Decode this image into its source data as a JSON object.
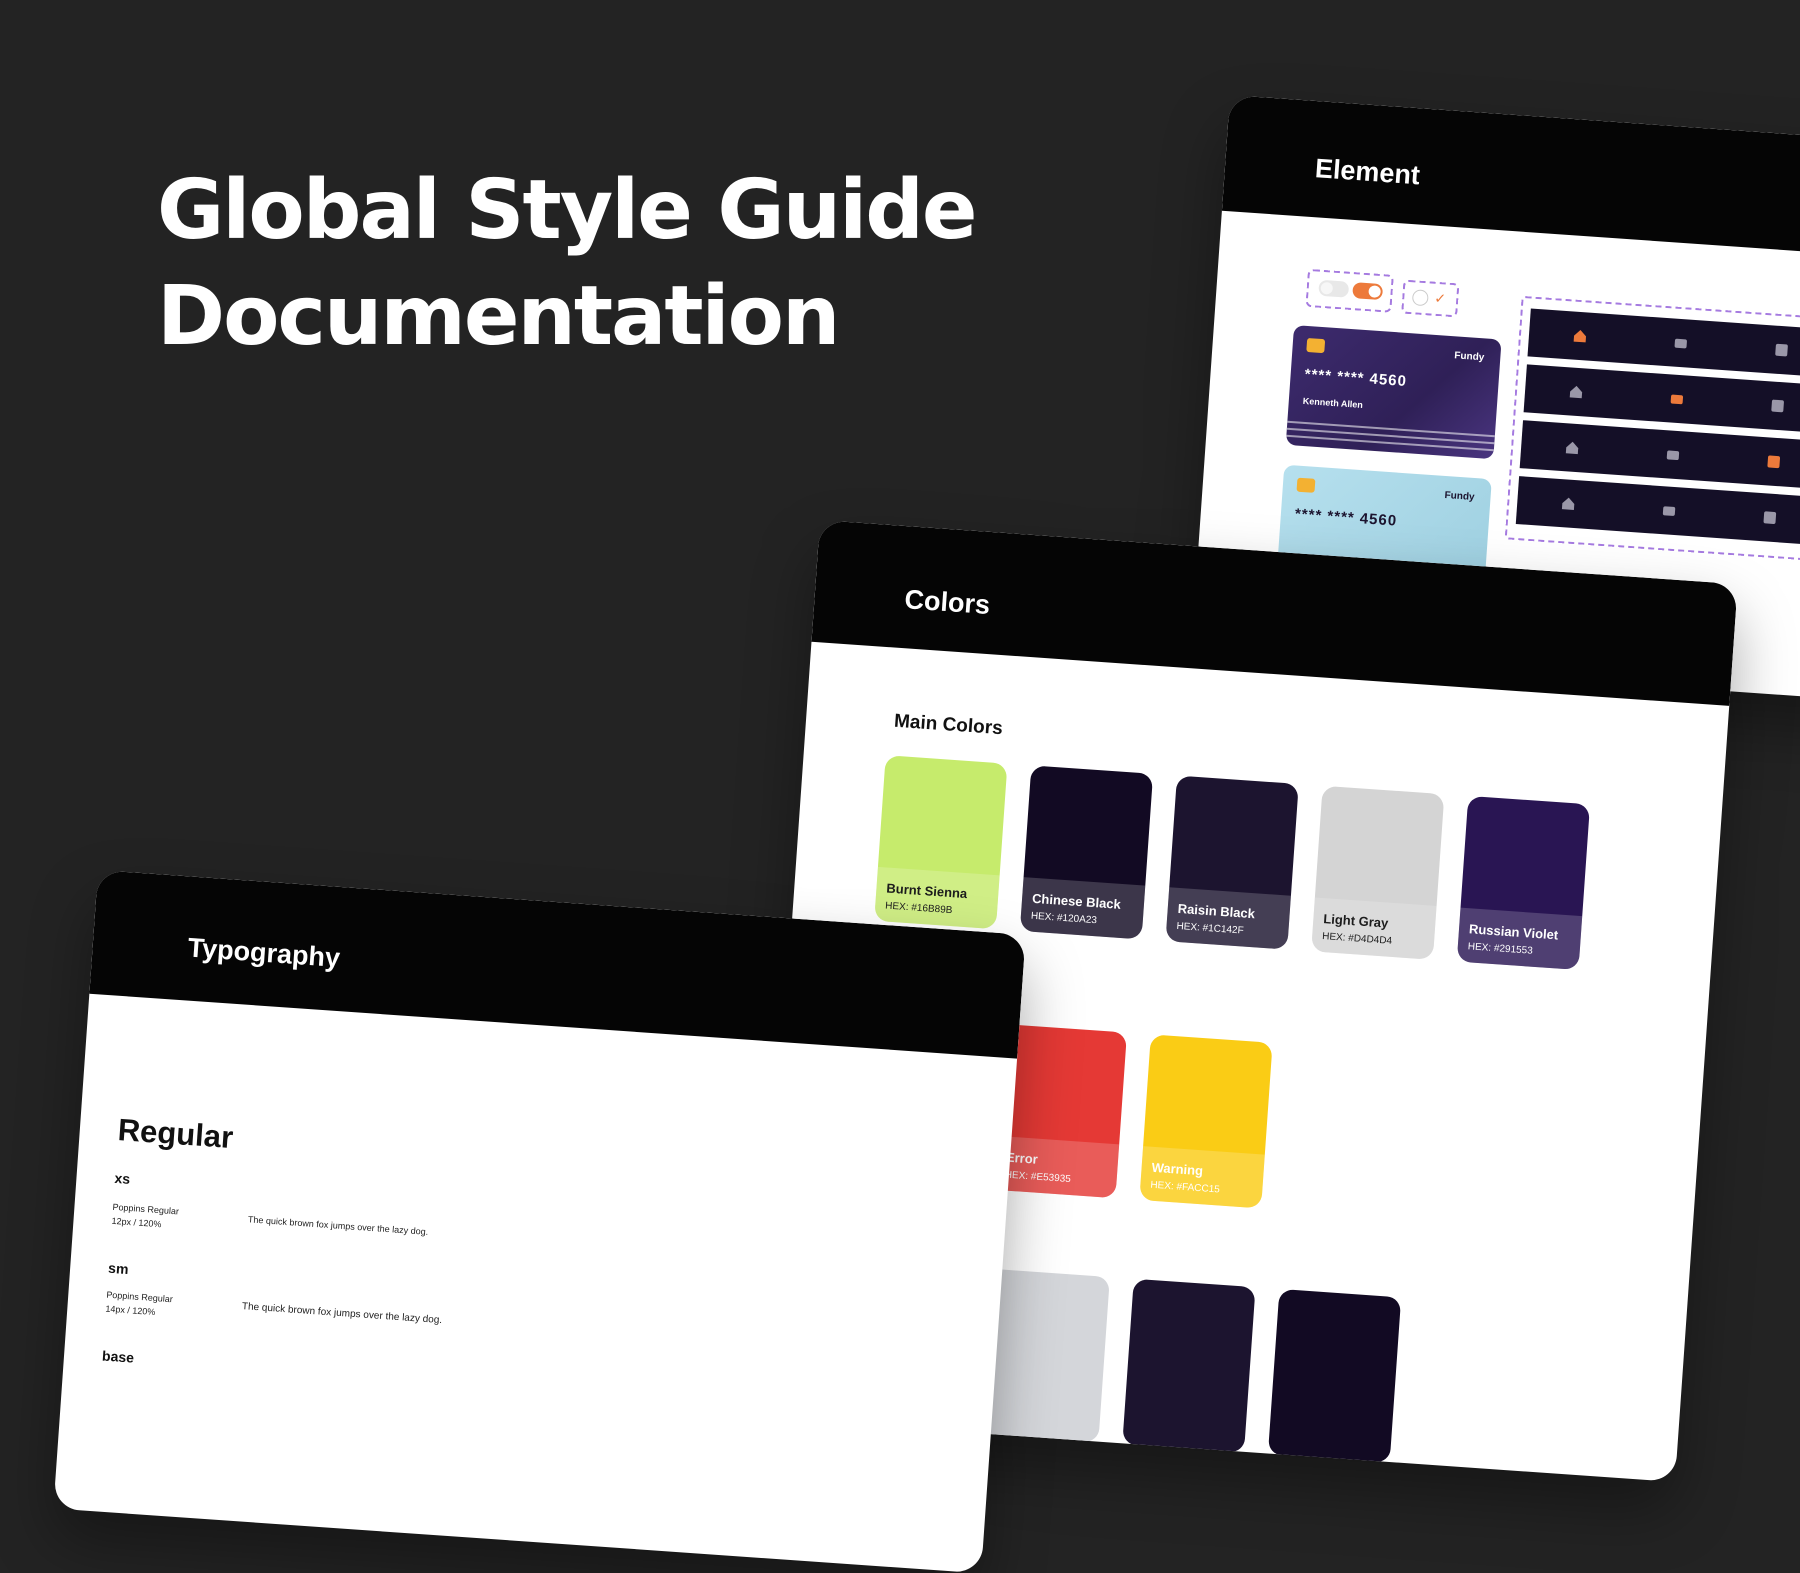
{
  "hero": {
    "line1": "Global Style Guide",
    "line2": "Documentation"
  },
  "element_panel": {
    "title": "Element",
    "cards": [
      {
        "brand": "Fundy",
        "number": "**** **** 4560",
        "holder": "Kenneth Allen",
        "color": "#3b2a6b"
      },
      {
        "brand": "Fundy",
        "number": "**** **** 4560",
        "holder": "",
        "color": "#a9d6e6"
      }
    ],
    "nav_icons": [
      "home-icon",
      "wallet-icon",
      "chart-icon",
      "user-icon"
    ],
    "accent_color": "#ed7a3b"
  },
  "colors_panel": {
    "title": "Colors",
    "main_colors_title": "Main Colors",
    "main_colors": [
      {
        "name": "Burnt Sienna",
        "hex": "HEX: #16B89B",
        "color": "#c6eb6c",
        "tone": "light"
      },
      {
        "name": "Chinese Black",
        "hex": "HEX: #120A23",
        "color": "#120a23",
        "tone": "dark"
      },
      {
        "name": "Raisin Black",
        "hex": "HEX: #1C142F",
        "color": "#1c142f",
        "tone": "dark"
      },
      {
        "name": "Light Gray",
        "hex": "HEX: #D4D4D4",
        "color": "#d4d4d4",
        "tone": "light"
      },
      {
        "name": "Russian Violet",
        "hex": "HEX: #291553",
        "color": "#291553",
        "tone": "dark"
      }
    ],
    "status_colors": [
      {
        "name": "Error",
        "hex": "HEX: #E53935",
        "color": "#e53935",
        "tone": "dark"
      },
      {
        "name": "Warning",
        "hex": "HEX: #FACC15",
        "color": "#facc15",
        "tone": "dark"
      }
    ]
  },
  "typography_panel": {
    "title": "Typography",
    "heading": "Regular",
    "sizes": [
      {
        "size": "xs",
        "font": "Poppins Regular",
        "spec": "12px / 120%",
        "sample": "The quick brown fox jumps over the lazy dog."
      },
      {
        "size": "sm",
        "font": "Poppins Regular",
        "spec": "14px / 120%",
        "sample": "The quick brown fox jumps over the lazy dog."
      },
      {
        "size": "base",
        "font": "",
        "spec": "",
        "sample": ""
      }
    ]
  }
}
